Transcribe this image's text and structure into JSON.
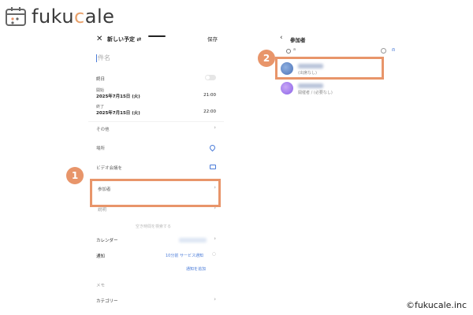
{
  "brand": {
    "name_pre": "fuku",
    "name_accent": "c",
    "name_post": "ale"
  },
  "left": {
    "close_icon": "close-icon",
    "title": "新しい予定",
    "save": "保存",
    "subject_placeholder": "件名",
    "all_day": "終日",
    "start_label": "開始",
    "start_date": "2025年7月15日 (火)",
    "start_time": "21:00",
    "end_label": "終了",
    "end_date": "2025年7月15日 (火)",
    "end_time": "22:00",
    "other": "その他",
    "place": "場所",
    "video": "ビデオ会議を",
    "attendees": "参加者",
    "repeat": "説明",
    "time_suggest": "空き時間を検索する",
    "calendar": "カレンダー",
    "notify": "通知",
    "notify_value": "10分前 サービス通知",
    "add_notify": "通知を追加",
    "memo": "メモ",
    "category": "カテゴリー"
  },
  "right": {
    "back_icon": "chevron-left-icon",
    "title": "参加者",
    "search_text": "a",
    "person1_sub": "(出席なし)",
    "person2_sub": "開催者 / (必要なし)"
  },
  "callouts": {
    "one": "1",
    "two": "2"
  },
  "copyright": "©fukucale.inc",
  "colors": {
    "accent": "#e8956a",
    "link": "#4a7bd8"
  }
}
